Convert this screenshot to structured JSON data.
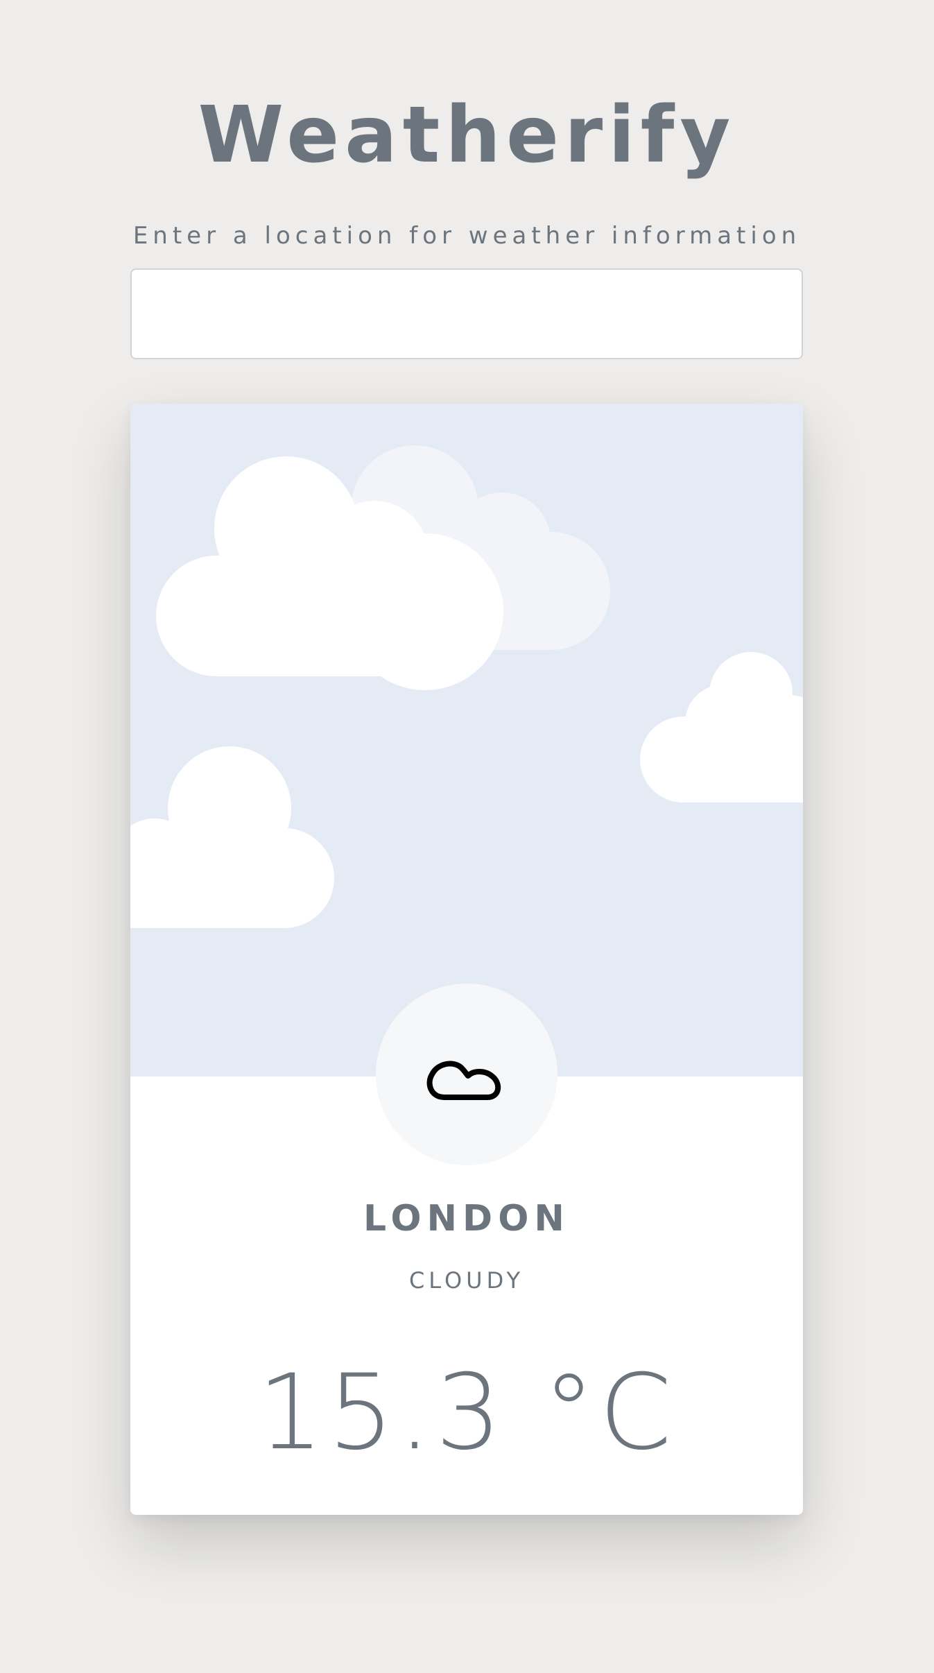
{
  "app": {
    "title": "Weatherify",
    "prompt": "Enter a location for weather information"
  },
  "search": {
    "value": "",
    "placeholder": ""
  },
  "weather": {
    "city": "LONDON",
    "condition": "CLOUDY",
    "temperature": "15.3 °C",
    "icon": "cloud-icon"
  },
  "colors": {
    "background": "#eeedeb",
    "text": "#6c757d",
    "sky": "#e5ebf5",
    "cloud": "#ffffff",
    "card": "#ffffff"
  }
}
